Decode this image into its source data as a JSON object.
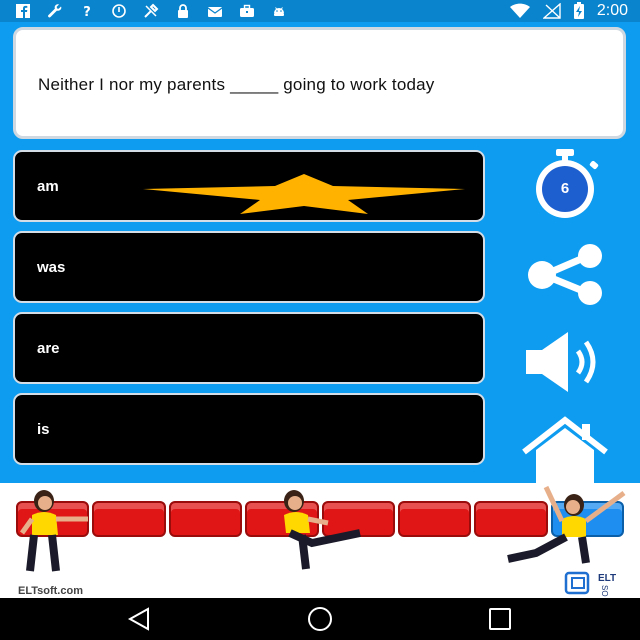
{
  "status_bar": {
    "time": "2:00",
    "left_icons": [
      "facebook-icon",
      "wrench-icon",
      "question-icon",
      "sync-disabled-icon",
      "tools-icon",
      "lock-icon",
      "email-icon",
      "briefcase-icon",
      "android-icon"
    ],
    "right_icons": [
      "wifi-icon",
      "signal-icon",
      "battery-charging-icon"
    ]
  },
  "question": {
    "text": "Neither I nor my parents _____ going to work today"
  },
  "answers": [
    {
      "label": "am"
    },
    {
      "label": "was"
    },
    {
      "label": "are"
    },
    {
      "label": "is"
    }
  ],
  "timer": {
    "value": "6"
  },
  "side_buttons": [
    "timer-icon",
    "share-icon",
    "speaker-icon",
    "home-icon"
  ],
  "progress": {
    "total_cells": 8,
    "active_cell": 8
  },
  "banner": {
    "brand": "ELTsoft.com",
    "logo_text": "ELT SOFT"
  },
  "nav_bar": [
    "back-icon",
    "home-circle-icon",
    "recent-apps-icon"
  ],
  "colors": {
    "background": "#0d9cf0",
    "answer_bg": "#000000",
    "star": "#ffb300",
    "timer_blue": "#1e5fd0",
    "progress_red": "#e01515",
    "progress_blue": "#1e8ef0"
  }
}
